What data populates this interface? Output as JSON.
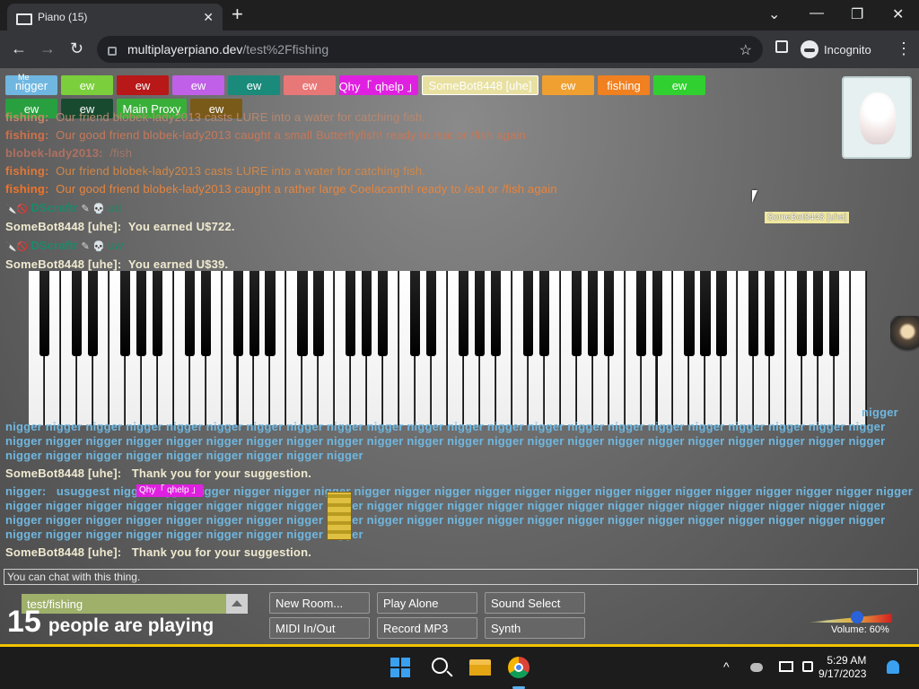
{
  "browser": {
    "tab_title": "Piano (15)",
    "tab_close": "✕",
    "new_tab": "+",
    "url_host": "multiplayerpiano.dev",
    "url_path": "/test%2Ffishing",
    "incognito_label": "Incognito",
    "back": "←",
    "forward": "→",
    "reload": "↻",
    "star": "☆",
    "menu": "⋮",
    "minimize": "—",
    "restore": "❐",
    "close": "✕",
    "chevron": "⌄"
  },
  "users": [
    {
      "label": "nigger",
      "sub": "Me",
      "color": "#6fb7e0"
    },
    {
      "label": "ew",
      "color": "#7ccf3c"
    },
    {
      "label": "ew",
      "color": "#b81818"
    },
    {
      "label": "ew",
      "color": "#c060e8"
    },
    {
      "label": "ew",
      "color": "#1a8a7a"
    },
    {
      "label": "ew",
      "color": "#e87878"
    },
    {
      "label": "Qhy「 qhelp 」",
      "color": "#e020e0"
    },
    {
      "label": "SomeBot8448 [uhe]",
      "color": "#e8e0a0"
    },
    {
      "label": "ew",
      "color": "#f0a030"
    },
    {
      "label": "fishing",
      "color": "#f08020"
    },
    {
      "label": "ew",
      "color": "#30d030"
    },
    {
      "label": "ew",
      "color": "#28a040"
    },
    {
      "label": "ew",
      "color": "#184a30"
    },
    {
      "label": "Main Proxy",
      "color": "#38b038"
    },
    {
      "label": "ew",
      "color": "#7a5a18"
    }
  ],
  "cursor_label": "SomeBot8448 [uhe]",
  "chat": [
    {
      "name": "fishing:",
      "text": "Our friend blobek-lady2013 casts LURE into a water for catching fish.",
      "ncolor": "#c88868",
      "tcolor": "#b88870"
    },
    {
      "name": "fishing:",
      "text": "Our good friend blobek-lady2013 caught a small Butterflyfish! ready to /eat or /fish again",
      "ncolor": "#d07048",
      "tcolor": "#c87858"
    },
    {
      "name": "blobek-lady2013:",
      "text": "/fish",
      "ncolor": "#b07060",
      "tcolor": "#a07868"
    },
    {
      "name": "fishing:",
      "text": "Our friend blobek-lady2013 casts LURE into a water for catching fish.",
      "ncolor": "#e07838",
      "tcolor": "#d08848"
    },
    {
      "name": "fishing:",
      "text": "Our good friend blobek-lady2013 caught a rather large Coelacanth! ready to /eat or /fish again",
      "ncolor": "#f07428",
      "tcolor": "#e8843c"
    },
    {
      "name": "DScraftr",
      "text": "ud",
      "ncolor": "#1a8a6a",
      "tcolor": "#1a8a6a",
      "icons": true
    },
    {
      "name": "SomeBot8448 [uhe]:",
      "text": "You earned U$722.",
      "ncolor": "#f0ead0",
      "tcolor": "#f0ead0"
    },
    {
      "name": "DScraftr",
      "text": "uw",
      "ncolor": "#1a8a6a",
      "tcolor": "#1a8a6a",
      "icons": true
    },
    {
      "name": "SomeBot8448 [uhe]:",
      "text": "You earned U$39.",
      "ncolor": "#f0ead0",
      "tcolor": "#f0ead0"
    }
  ],
  "chat_lower": {
    "wrap1": "nigger",
    "wrap2": "nigger nigger nigger nigger nigger nigger nigger nigger nigger nigger nigger nigger nigger nigger nigger nigger nigger nigger nigger nigger nigger nigger",
    "wrap3": "nigger nigger nigger nigger nigger nigger nigger nigger nigger nigger nigger nigger nigger nigger nigger nigger nigger nigger nigger nigger nigger nigger",
    "wrap4": "nigger nigger nigger nigger nigger nigger nigger nigger nigger",
    "bot1_name": "SomeBot8448 [uhe]:",
    "bot1_text": "Thank you for your suggestion.",
    "user_name": "nigger:",
    "user_line1": "usuggest nigger nigger nigger nigger nigger nigger nigger nigger nigger nigger nigger nigger nigger nigger nigger nigger nigger nigger nigger nigger",
    "user_line2": "nigger nigger nigger nigger nigger nigger nigger nigger nigger nigger nigger nigger nigger nigger nigger nigger nigger nigger nigger nigger nigger nigger",
    "user_line3": "nigger nigger nigger nigger nigger nigger nigger nigger nigger nigger nigger nigger nigger nigger nigger nigger nigger nigger nigger nigger nigger nigger",
    "user_line4": "nigger nigger nigger nigger nigger nigger nigger nigger nigger",
    "bot2_name": "SomeBot8448 [uhe]:",
    "bot2_text": "Thank you for your suggestion.",
    "qhy_cursor": "Qhy「 qhelp 」"
  },
  "chat_input_placeholder": "You can chat with this thing.",
  "controls": {
    "room": "test/fishing",
    "player_count": "15",
    "players_text": "people are playing",
    "buttons": [
      "New Room...",
      "Play Alone",
      "Sound Select",
      "MIDI In/Out",
      "Record MP3",
      "Synth"
    ],
    "volume_label": "Volume: 60%",
    "volume_value": 0.6
  },
  "taskbar": {
    "time": "5:29 AM",
    "date": "9/17/2023",
    "tray_chevron": "^"
  }
}
